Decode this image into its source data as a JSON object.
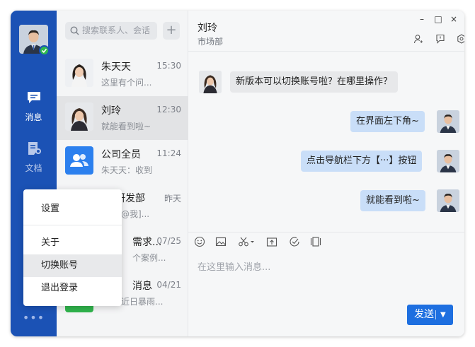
{
  "nav": {
    "items": [
      {
        "label": "消息"
      },
      {
        "label": "文档"
      }
    ],
    "more_label": "•••"
  },
  "search": {
    "placeholder": "搜索联系人、会话"
  },
  "conversations": [
    {
      "name": "朱天天",
      "time": "15:30",
      "preview": "这里有个问..."
    },
    {
      "name": "刘玲",
      "time": "12:30",
      "preview": "就能看到啦~"
    },
    {
      "name": "公司全员",
      "time": "11:24",
      "preview": "朱天天：收到"
    },
    {
      "name": "研发部",
      "time": "昨天",
      "preview": "@我]..."
    },
    {
      "name": "需求...",
      "time": "07/25",
      "preview": "个案例..."
    },
    {
      "name": "消息",
      "time": "04/21",
      "preview": "因近日暴雨..."
    }
  ],
  "chat": {
    "title": "刘玲",
    "subtitle": "市场部",
    "window_controls": {
      "minimize": "–",
      "maximize": "□",
      "close": "×"
    },
    "messages": [
      {
        "direction": "in",
        "text": "新版本可以切换账号啦？在哪里操作？"
      },
      {
        "direction": "out",
        "text": "在界面左下角~"
      },
      {
        "direction": "out",
        "text": "点击导航栏下方【···】按钮"
      },
      {
        "direction": "out",
        "text": "就能看到啦~"
      }
    ],
    "input_placeholder": "在这里输入消息...",
    "send_label": "发送"
  },
  "menu": {
    "items": [
      {
        "label": "设置"
      },
      {
        "label": "关于"
      },
      {
        "label": "切换账号"
      },
      {
        "label": "退出登录"
      }
    ]
  },
  "colors": {
    "rail": "#1b52b5",
    "accent": "#1e6fe0",
    "outgoing_bubble": "#c9def8",
    "online": "#2fb84f"
  }
}
